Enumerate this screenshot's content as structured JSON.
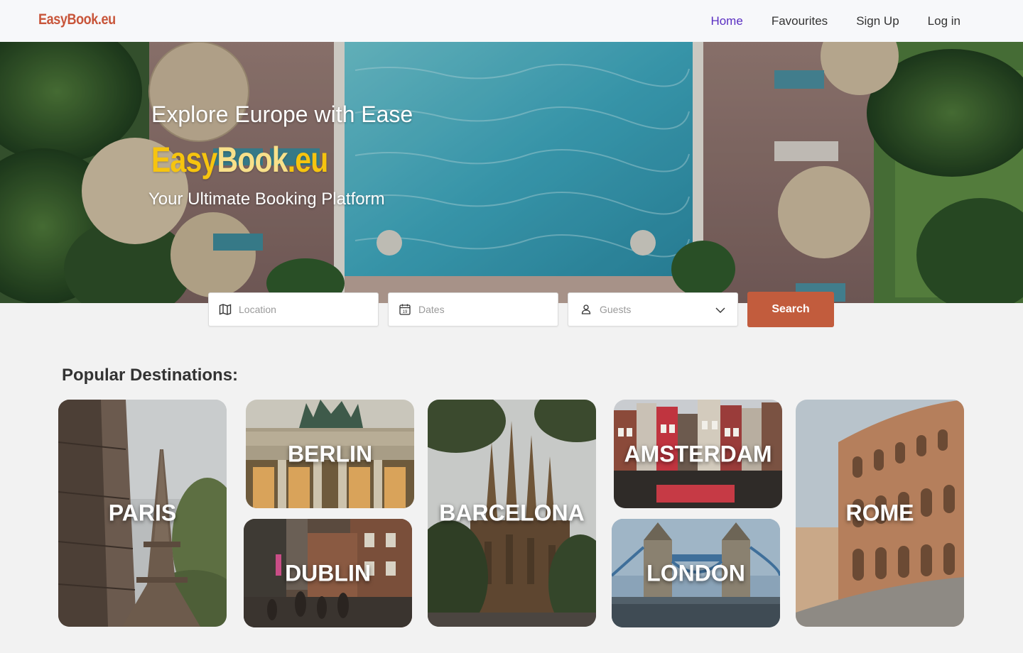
{
  "nav": {
    "logo": "EasyBook.eu",
    "links": [
      {
        "label": "Home",
        "active": true
      },
      {
        "label": "Favourites",
        "active": false
      },
      {
        "label": "Sign Up",
        "active": false
      },
      {
        "label": "Log in",
        "active": false
      }
    ]
  },
  "hero": {
    "headline": "Explore Europe with Ease",
    "brand_part1": "Easy",
    "brand_part2": "Book",
    "brand_part3": ".eu",
    "tagline": "Your Ultimate Booking Platform"
  },
  "search": {
    "location_placeholder": "Location",
    "dates_placeholder": "Dates",
    "guests_placeholder": "Guests",
    "button_label": "Search",
    "calendar_day": "19"
  },
  "destinations": {
    "title": "Popular Destinations:",
    "items": [
      {
        "name": "PARIS"
      },
      {
        "name": "BERLIN"
      },
      {
        "name": "DUBLIN"
      },
      {
        "name": "BARCELONA"
      },
      {
        "name": "AMSTERDAM"
      },
      {
        "name": "LONDON"
      },
      {
        "name": "ROME"
      }
    ]
  },
  "colors": {
    "brand_orange": "#c8553a",
    "brand_yellow": "#f6c40f",
    "nav_active": "#5a2fc2",
    "search_button": "#c25c3d"
  }
}
